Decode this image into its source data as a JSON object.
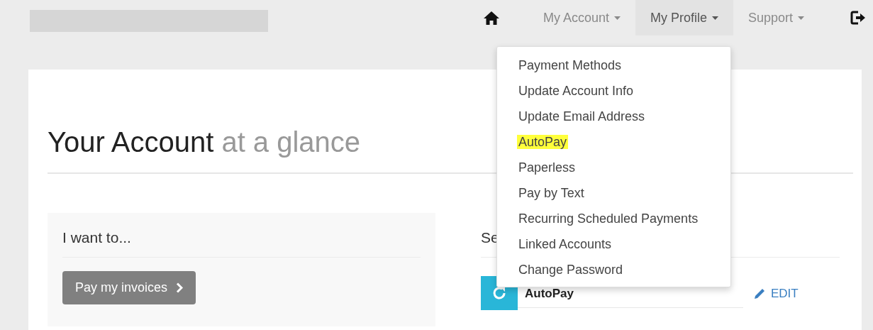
{
  "header": {
    "nav": [
      {
        "kind": "home"
      },
      {
        "kind": "menu",
        "label": "My Account",
        "selected": false
      },
      {
        "kind": "menu",
        "label": "My Profile",
        "selected": true
      },
      {
        "kind": "menu",
        "label": "Support",
        "selected": false
      },
      {
        "kind": "logout"
      }
    ]
  },
  "dropdown": {
    "items": [
      {
        "label": "Payment Methods",
        "highlighted": false
      },
      {
        "label": "Update Account Info",
        "highlighted": false
      },
      {
        "label": "Update Email Address",
        "highlighted": false
      },
      {
        "label": "AutoPay",
        "highlighted": true
      },
      {
        "label": "Paperless",
        "highlighted": false
      },
      {
        "label": "Pay by Text",
        "highlighted": false
      },
      {
        "label": "Recurring Scheduled Payments",
        "highlighted": false
      },
      {
        "label": "Linked Accounts",
        "highlighted": false
      },
      {
        "label": "Change Password",
        "highlighted": false
      }
    ]
  },
  "page": {
    "title": "Your Account",
    "subtitle": "at a glance",
    "left_panel": {
      "heading": "I want to...",
      "button": "Pay my invoices"
    },
    "right_panel": {
      "heading": "Se",
      "rows": [
        {
          "label": "AutoPay",
          "action": "EDIT"
        }
      ]
    }
  }
}
